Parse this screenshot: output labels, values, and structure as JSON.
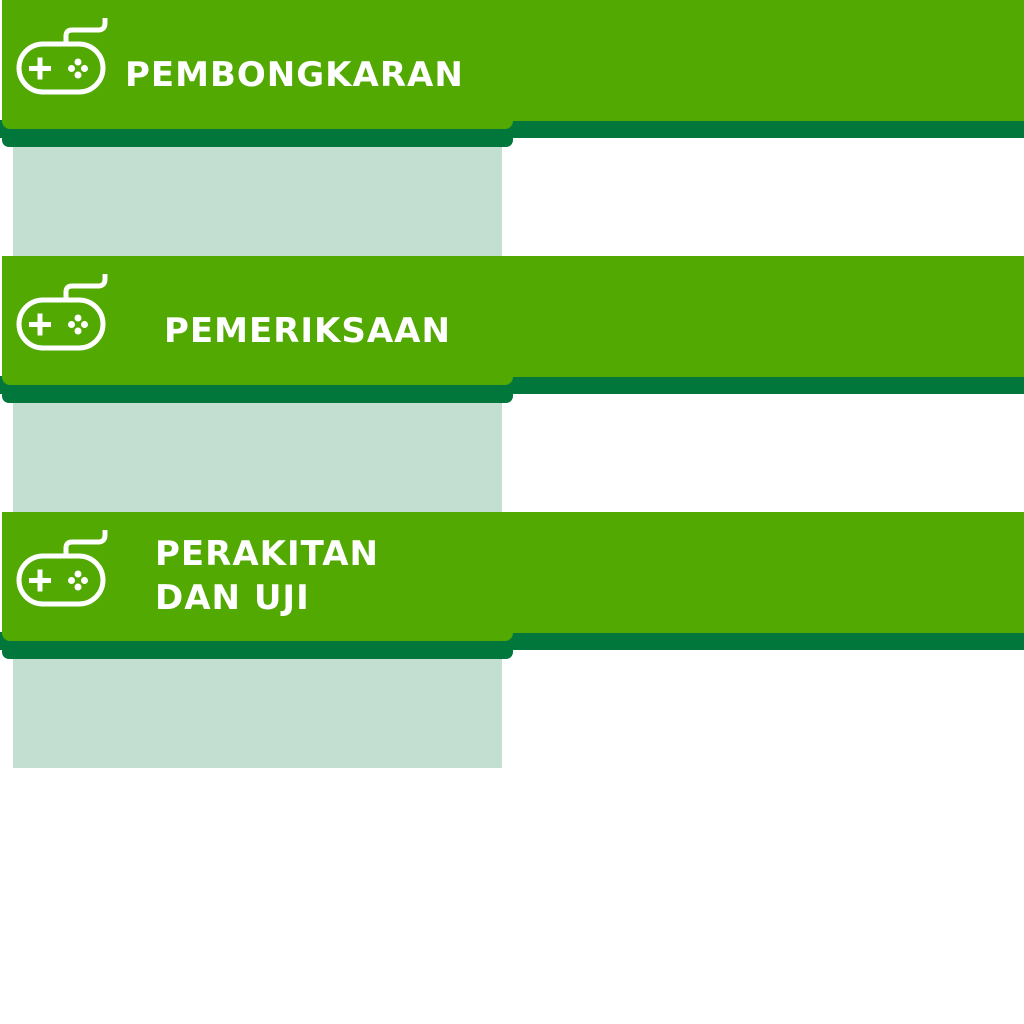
{
  "sections": [
    {
      "label_lines": [
        "PEMBONGKARAN"
      ],
      "icon": "gamepad-icon"
    },
    {
      "label_lines": [
        "PEMERIKSAAN"
      ],
      "icon": "gamepad-icon"
    },
    {
      "label_lines": [
        "PERAKITAN",
        "DAN UJI"
      ],
      "icon": "gamepad-icon"
    }
  ],
  "colors": {
    "bar_green": "#52a902",
    "stripe_dark_green": "#02773b",
    "panel_light_green": "#c3dfd1",
    "text": "#ffffff"
  }
}
